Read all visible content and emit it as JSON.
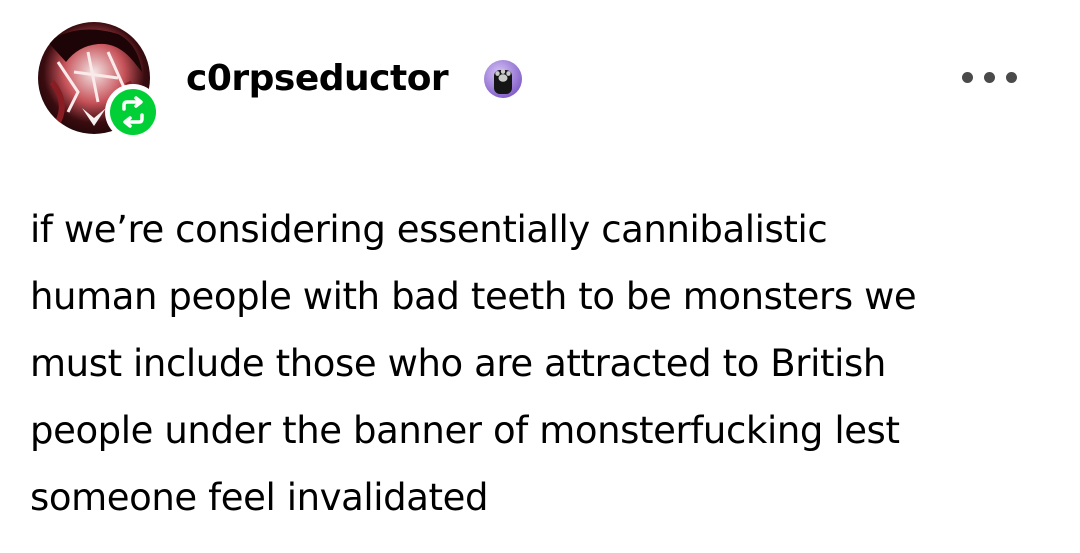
{
  "post": {
    "author": {
      "username": "c0rpseductor",
      "avatar_icon": "avatar-image",
      "reblog_icon": "reblog-icon",
      "badge_icon": "paw-badge-icon"
    },
    "menu": {
      "icon": "more-options-icon"
    },
    "body_lines": [
      "if we’re considering essentially cannibalistic",
      "human people with bad teeth to be monsters we",
      "must include those who are attracted to British",
      "people under the banner of monsterfucking lest",
      "someone feel invalidated"
    ]
  },
  "colors": {
    "reblog_green": "#00cf35",
    "badge_purple": "#9b7ad8",
    "text": "#000000",
    "muted_icon": "#4a4a4a",
    "background": "#ffffff"
  }
}
